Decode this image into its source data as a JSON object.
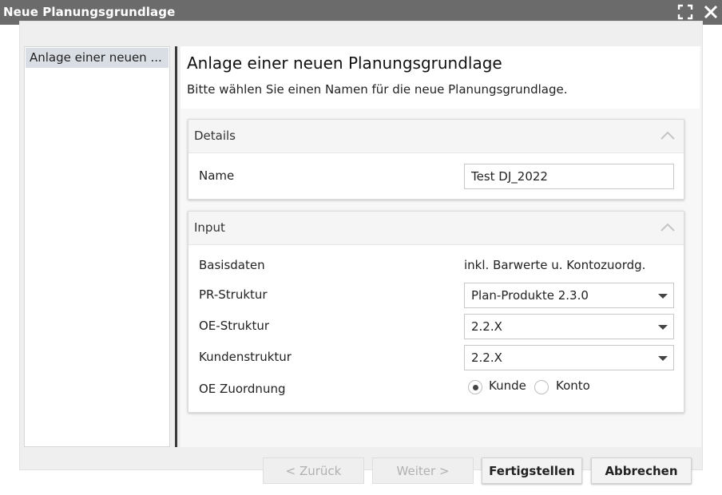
{
  "window": {
    "title": "Neue Planungsgrundlage"
  },
  "steps": [
    {
      "label": "Anlage einer neuen ..."
    }
  ],
  "page": {
    "title": "Anlage einer neuen Planungsgrundlage",
    "subtitle": "Bitte wählen Sie einen Namen für die neue Planungsgrundlage."
  },
  "details": {
    "title": "Details",
    "name_label": "Name",
    "name_value": "Test DJ_2022"
  },
  "input": {
    "title": "Input",
    "basisdaten_label": "Basisdaten",
    "basisdaten_value": "inkl. Barwerte u. Kontozuordg.",
    "pr_label": "PR-Struktur",
    "pr_value": "Plan-Produkte 2.3.0",
    "oe_label": "OE-Struktur",
    "oe_value": "2.2.X",
    "kunden_label": "Kundenstruktur",
    "kunden_value": "2.2.X",
    "zuordnung_label": "OE Zuordnung",
    "zuordnung_options": [
      "Kunde",
      "Konto"
    ],
    "zuordnung_selected": "Kunde"
  },
  "footer": {
    "back_label": "< Zurück",
    "next_label": "Weiter >",
    "finish_label": "Fertigstellen",
    "cancel_label": "Abbrechen"
  },
  "icons": {
    "maximize": "maximize-icon",
    "close": "close-icon",
    "collapse": "chevron-up-icon",
    "dropdown": "caret-down-icon"
  },
  "colors": {
    "titlebar": "#6b6b6b",
    "selected_step": "#d9dde4",
    "divider": "#3a3a3a"
  }
}
